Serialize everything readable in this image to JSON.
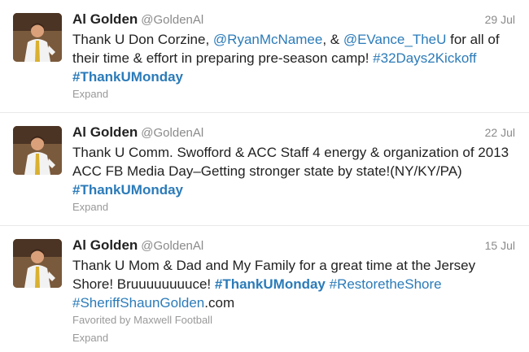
{
  "tweets": [
    {
      "name": "Al Golden",
      "handle": "@GoldenAl",
      "date": "29 Jul",
      "parts": [
        {
          "t": "Thank U Don Corzine, ",
          "k": "text"
        },
        {
          "t": "@RyanMcNamee",
          "k": "link"
        },
        {
          "t": ", & ",
          "k": "text"
        },
        {
          "t": "@EVance_TheU",
          "k": "link"
        },
        {
          "t": " for all of their time & effort in preparing pre-season camp! ",
          "k": "text"
        },
        {
          "t": "#32Days2Kickoff",
          "k": "link"
        },
        {
          "t": " ",
          "k": "text"
        },
        {
          "t": "#ThankUMonday",
          "k": "tag"
        }
      ],
      "favorited_by": "",
      "expand_label": "Expand"
    },
    {
      "name": "Al Golden",
      "handle": "@GoldenAl",
      "date": "22 Jul",
      "parts": [
        {
          "t": "Thank U Comm. Swofford & ACC Staff 4 energy & organization of 2013 ACC FB Media Day–Getting stronger state by state!(NY/KY/PA) ",
          "k": "text"
        },
        {
          "t": "#ThankUMonday",
          "k": "tag"
        }
      ],
      "favorited_by": "",
      "expand_label": "Expand"
    },
    {
      "name": "Al Golden",
      "handle": "@GoldenAl",
      "date": "15 Jul",
      "parts": [
        {
          "t": "Thank U Mom & Dad and My Family for a great time at the Jersey Shore! Bruuuuuuuuce! ",
          "k": "text"
        },
        {
          "t": "#ThankUMonday",
          "k": "tag"
        },
        {
          "t": " ",
          "k": "text"
        },
        {
          "t": "#RestoretheShore",
          "k": "link"
        },
        {
          "t": " ",
          "k": "text"
        },
        {
          "t": "#SheriffShaunGolden",
          "k": "link"
        },
        {
          "t": ".com",
          "k": "text"
        }
      ],
      "favorited_by": "Favorited by Maxwell Football",
      "expand_label": "Expand"
    }
  ],
  "colors": {
    "link": "#2b7bb9",
    "meta": "#999999",
    "name": "#222222"
  },
  "icons": {
    "avatar": "profile-photo-icon"
  }
}
